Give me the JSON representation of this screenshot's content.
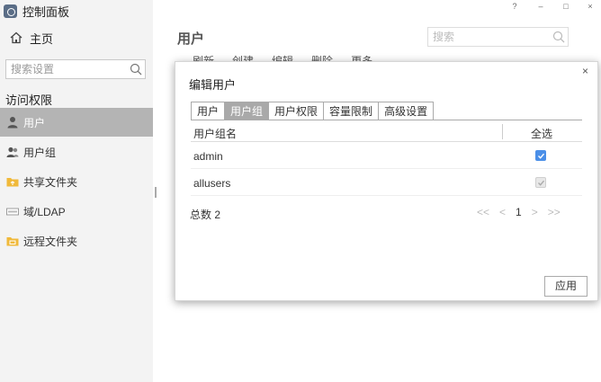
{
  "app": {
    "title": "控制面板"
  },
  "window_controls": {
    "help": "?",
    "minimize": "–",
    "maximize": "□",
    "close": "×"
  },
  "sidebar": {
    "home_label": "主页",
    "search_placeholder": "搜索设置",
    "section_label": "访问权限",
    "items": [
      {
        "label": "用户",
        "icon": "user-icon",
        "active": true
      },
      {
        "label": "用户组",
        "icon": "user-group-icon",
        "active": false
      },
      {
        "label": "共享文件夹",
        "icon": "shared-folder-icon",
        "active": false
      },
      {
        "label": "域/LDAP",
        "icon": "ldap-icon",
        "active": false
      },
      {
        "label": "远程文件夹",
        "icon": "remote-folder-icon",
        "active": false
      }
    ]
  },
  "main": {
    "title": "用户",
    "search_placeholder": "搜索",
    "toolbar": [
      "刷新",
      "创建",
      "编辑",
      "删除",
      "更多 ⌄"
    ]
  },
  "dialog": {
    "title": "编辑用户",
    "close": "×",
    "tabs": [
      {
        "label": "用户",
        "active": false
      },
      {
        "label": "用户组",
        "active": true
      },
      {
        "label": "用户权限",
        "active": false
      },
      {
        "label": "容量限制",
        "active": false
      },
      {
        "label": "高级设置",
        "active": false
      }
    ],
    "columns": {
      "name": "用户组名",
      "select_all": "全选"
    },
    "rows": [
      {
        "name": "admin",
        "checked": true,
        "disabled": false
      },
      {
        "name": "allusers",
        "checked": true,
        "disabled": true
      }
    ],
    "total": "总数 2",
    "pager": {
      "first": "<<",
      "prev": "<",
      "page": "1",
      "next": ">",
      "last": ">>"
    },
    "apply_label": "应用"
  },
  "colors": {
    "accent": "#4b8fe8",
    "sidebar_bg": "#f3f3f3",
    "active_nav": "#b4b4b4",
    "active_tab": "#a9a9a9"
  }
}
